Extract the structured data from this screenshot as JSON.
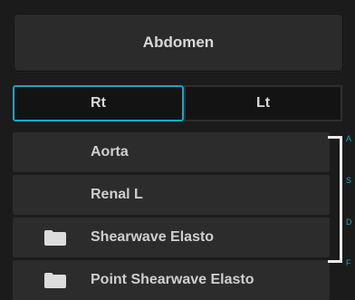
{
  "header": {
    "title": "Abdomen"
  },
  "side_toggle": {
    "rt_label": "Rt",
    "lt_label": "Lt",
    "selected": "Rt"
  },
  "list": {
    "items": [
      {
        "label": "Aorta",
        "icon": null
      },
      {
        "label": "Renal L",
        "icon": null
      },
      {
        "label": "Shearwave Elasto",
        "icon": "folder-icon"
      },
      {
        "label": "Point Shearwave Elasto",
        "icon": "folder-icon"
      }
    ]
  },
  "scrollbar_labels": {
    "letters": [
      "A",
      "S",
      "D",
      "F"
    ]
  },
  "colors": {
    "accent": "#19a7c4",
    "background": "#1b1b1b",
    "button": "#2b2b2b",
    "list_item": "#2c2c2c",
    "text": "#d8d8d8"
  }
}
